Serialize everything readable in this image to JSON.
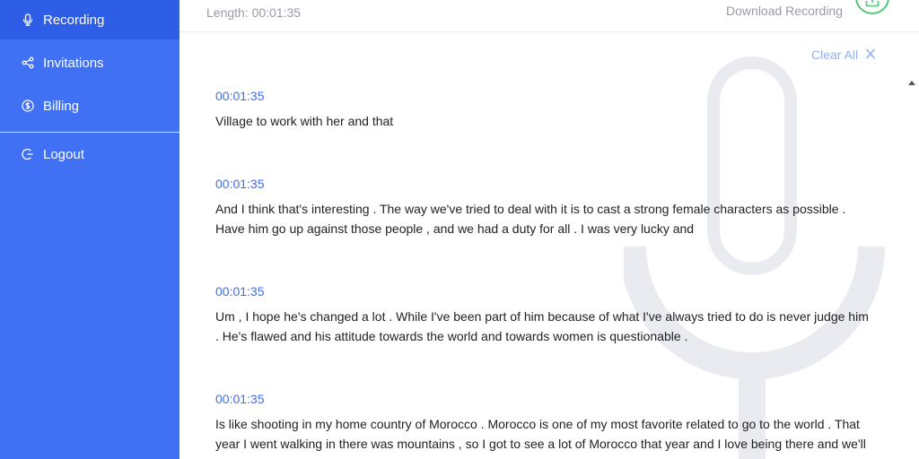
{
  "sidebar": {
    "items": [
      {
        "label": "Recording",
        "icon": "microphone-icon"
      },
      {
        "label": "Invitations",
        "icon": "share-icon"
      },
      {
        "label": "Billing",
        "icon": "dollar-circle-icon"
      }
    ],
    "logout": {
      "label": "Logout",
      "icon": "logout-icon"
    }
  },
  "topbar": {
    "length": "Length: 00:01:35",
    "download_label": "Download Recording"
  },
  "transcript": {
    "clear_all": "Clear All",
    "entries": [
      {
        "time": "00:01:35",
        "text": "Village to work with her and that"
      },
      {
        "time": "00:01:35",
        "text": "And I think that's interesting . The way we've tried to deal with it is to cast a strong female characters as possible . Have him go up against those people , and we had a duty for all . I was very lucky and"
      },
      {
        "time": "00:01:35",
        "text": "Um , I hope he's changed a lot . While I've been part of him because of what I've always tried to do is never judge him . He's flawed and his attitude towards the world and towards women is questionable ."
      },
      {
        "time": "00:01:35",
        "text": "Is like shooting in my home country of Morocco . Morocco is one of my most favorite related to go to the world . That year I went walking in there was mountains , so I got to see a lot of Morocco that year and I love being there and we'll get back there as soon as I can. Usually we think we are going to be in the Gizeh next with today's presentation"
      }
    ]
  },
  "colors": {
    "sidebar_bg": "#4070f4",
    "sidebar_active": "#2f5ee6",
    "accent": "#3f6ee8",
    "download_green": "#52c77a"
  }
}
